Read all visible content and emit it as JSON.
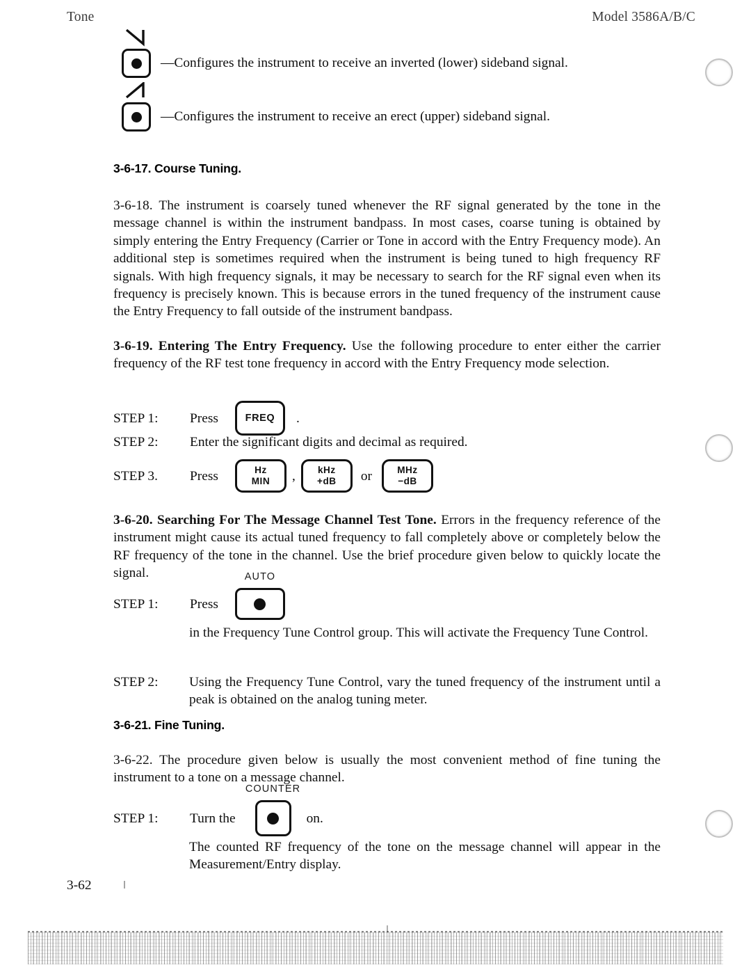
{
  "header": {
    "left": "Tone",
    "right": "Model 3586A/B/C"
  },
  "sideband_items": [
    {
      "icon": "inverted-sideband-triangle-icon",
      "text": "—Configures the instrument to receive an inverted (lower) sideband signal."
    },
    {
      "icon": "erect-sideband-triangle-icon",
      "text": "—Configures the instrument to receive an erect (upper) sideband signal."
    }
  ],
  "sections": {
    "course_tuning_heading": "3-6-17.  Course Tuning.",
    "para_3_6_18": "3-6-18.  The instrument is coarsely tuned whenever the RF signal generated by the tone in the message channel is within the instrument bandpass. In most cases, coarse tuning is obtained by simply entering the Entry Frequency (Carrier or Tone in accord with the Entry Frequency mode). An additional step is sometimes required when the instrument is being tuned to high frequency RF signals. With high frequency signals, it may be necessary to search for the RF signal even when its frequency is precisely known. This is because errors in the tuned frequency of the instrument cause the Entry Frequency to fall outside of the instrument bandpass.",
    "para_3_6_19_bold": "3-6-19.  Entering The Entry Frequency.",
    "para_3_6_19_rest": "  Use the following procedure to enter either the carrier frequency of the RF test tone frequency in accord with the Entry Frequency mode selection.",
    "para_3_6_20_bold": "3-6-20.  Searching For The Message Channel Test Tone.",
    "para_3_6_20_rest": "  Errors in the frequency reference of the instrument might cause its actual tuned frequency to fall completely above or completely below the RF frequency of the tone in the channel. Use the brief procedure given below to quickly locate the signal.",
    "fine_tuning_heading": "3-6-21.  Fine Tuning.",
    "para_3_6_22": "3-6-22.  The procedure given below is usually the most convenient method of fine tuning the instrument to a tone on a message channel."
  },
  "entry_steps": {
    "step1_label": "STEP 1:",
    "step1_verb": "Press",
    "step1_key": "FREQ",
    "step1_period": ".",
    "step2_label": "STEP 2:",
    "step2_text": "Enter the significant digits and decimal as required.",
    "step3_label": "STEP 3.",
    "step3_verb": "Press",
    "step3_keys": [
      {
        "line1": "Hz",
        "line2": "MIN"
      },
      {
        "line1": "kHz",
        "line2": "+dB"
      },
      {
        "line1": "MHz",
        "line2": "−dB"
      }
    ],
    "step3_sep_comma": ",",
    "step3_sep_or": "or"
  },
  "search_steps": {
    "step1_label": "STEP 1:",
    "step1_verb": "Press",
    "step1_key_toplabel": "AUTO",
    "step1_key_icon": "round-indicator-dot-icon",
    "step1_body": "in the Frequency Tune Control group. This will activate the Frequency Tune Control.",
    "step2_label": "STEP 2:",
    "step2_body": "Using the Frequency Tune Control, vary the tuned frequency of the instrument until a peak is obtained on the analog tuning meter."
  },
  "fine_steps": {
    "step1_label": "STEP 1:",
    "step1_verb": "Turn the",
    "step1_key_toplabel": "COUNTER",
    "step1_key_icon": "round-indicator-dot-icon",
    "step1_trailing": "on.",
    "step1_body": "The counted RF frequency of the tone on the message channel will appear in the Measurement/Entry display."
  },
  "folio": "3-62",
  "colors": {
    "ink": "#121212",
    "paper": "#ffffff",
    "artifact_gray": "#787878"
  }
}
